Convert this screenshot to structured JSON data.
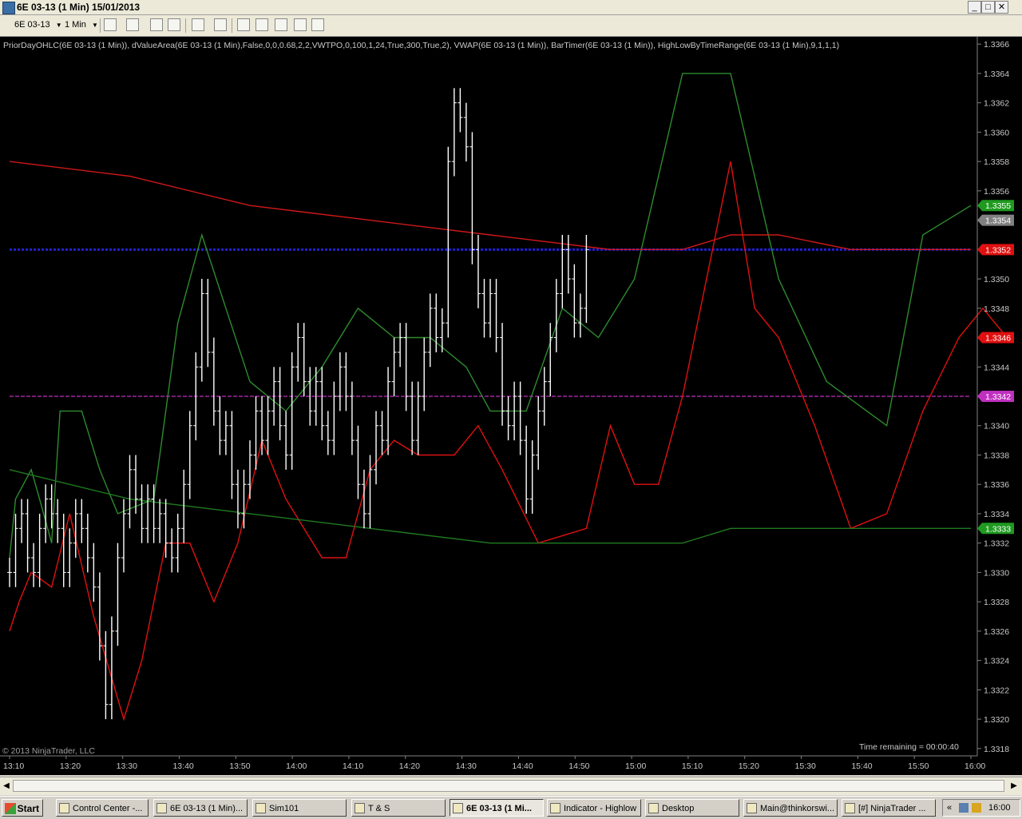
{
  "window": {
    "title": "6E 03-13 (1 Min)  15/01/2013",
    "controls": [
      "_",
      "□",
      "✕"
    ]
  },
  "toolbar": {
    "instrument": "6E 03-13",
    "interval": "1 Min"
  },
  "chart": {
    "indicator_line": "PriorDayOHLC(6E 03-13 (1 Min)), dValueArea(6E 03-13 (1 Min),False,0,0,0.68,2,2,VWTPO,0,100,1,24,True,300,True,2), VWAP(6E 03-13 (1 Min)), BarTimer(6E 03-13 (1 Min)), HighLowByTimeRange(6E 03-13 (1 Min),9,1,1,1)",
    "copyright": "© 2013 NinjaTrader, LLC",
    "time_remaining": "Time remaining = 00:00:40",
    "colors": {
      "background": "#000000",
      "bars": "#ffffff",
      "high_band": "#2e8b2e",
      "low_band": "#e01010",
      "vwap": "#d01818",
      "value_area": "#2020d0",
      "poc": "#c030c0",
      "lower_green": "#1f7a1f"
    }
  },
  "chart_data": {
    "type": "line",
    "instrument": "6E 03-13",
    "interval": "1 Min",
    "x_ticks": [
      "13:10",
      "13:20",
      "13:30",
      "13:40",
      "13:50",
      "14:00",
      "14:10",
      "14:20",
      "14:30",
      "14:40",
      "14:50",
      "15:00",
      "15:10",
      "15:20",
      "15:30",
      "15:40",
      "15:50",
      "16:00"
    ],
    "y_ticks": [
      "1.3318",
      "1.3320",
      "1.3322",
      "1.3324",
      "1.3326",
      "1.3328",
      "1.3330",
      "1.3332",
      "1.3334",
      "1.3336",
      "1.3338",
      "1.3340",
      "1.3342",
      "1.3344",
      "1.3346",
      "1.3348",
      "1.3350",
      "1.3352",
      "1.3354",
      "1.3356",
      "1.3358",
      "1.3360",
      "1.3362",
      "1.3364",
      "1.3366"
    ],
    "ylim": [
      1.33175,
      1.33665
    ],
    "price_markers": [
      {
        "label": "1.3355",
        "value": 1.3355,
        "color": "#1f9a1f"
      },
      {
        "label": "1.3354",
        "value": 1.3354,
        "color": "#808080"
      },
      {
        "label": "1.3352",
        "value": 1.3352,
        "color": "#e01010"
      },
      {
        "label": "1.3346",
        "value": 1.3346,
        "color": "#e01010"
      },
      {
        "label": "1.3342",
        "value": 1.3342,
        "color": "#c030c0"
      },
      {
        "label": "1.3333",
        "value": 1.3333,
        "color": "#1f9a1f"
      }
    ],
    "horizontal_levels": [
      {
        "name": "value-area-high",
        "value": 1.3352
      },
      {
        "name": "point-of-control",
        "value": 1.3342
      }
    ],
    "series": [
      {
        "key": "high_band",
        "points": [
          [
            0,
            1.3331
          ],
          [
            5,
            1.3335
          ],
          [
            18,
            1.3337
          ],
          [
            25,
            1.3335
          ],
          [
            35,
            1.3332
          ],
          [
            42,
            1.3341
          ],
          [
            60,
            1.3341
          ],
          [
            75,
            1.3337
          ],
          [
            90,
            1.3334
          ],
          [
            120,
            1.3335
          ],
          [
            140,
            1.3347
          ],
          [
            160,
            1.3353
          ],
          [
            180,
            1.3348
          ],
          [
            200,
            1.3343
          ],
          [
            230,
            1.3341
          ],
          [
            260,
            1.3344
          ],
          [
            290,
            1.3348
          ],
          [
            320,
            1.3346
          ],
          [
            350,
            1.3346
          ],
          [
            380,
            1.3344
          ],
          [
            400,
            1.3341
          ],
          [
            430,
            1.3341
          ],
          [
            460,
            1.3348
          ],
          [
            490,
            1.3346
          ],
          [
            520,
            1.335
          ],
          [
            560,
            1.3364
          ],
          [
            600,
            1.3364
          ],
          [
            640,
            1.335
          ],
          [
            680,
            1.3343
          ],
          [
            730,
            1.334
          ],
          [
            760,
            1.3353
          ],
          [
            800,
            1.3355
          ]
        ]
      },
      {
        "key": "low_band",
        "points": [
          [
            0,
            1.3326
          ],
          [
            8,
            1.3328
          ],
          [
            18,
            1.333
          ],
          [
            35,
            1.3329
          ],
          [
            50,
            1.3334
          ],
          [
            70,
            1.3327
          ],
          [
            95,
            1.332
          ],
          [
            110,
            1.3324
          ],
          [
            130,
            1.3332
          ],
          [
            150,
            1.3332
          ],
          [
            170,
            1.3328
          ],
          [
            190,
            1.3332
          ],
          [
            210,
            1.3339
          ],
          [
            230,
            1.3335
          ],
          [
            260,
            1.3331
          ],
          [
            280,
            1.3331
          ],
          [
            300,
            1.3337
          ],
          [
            320,
            1.3339
          ],
          [
            340,
            1.3338
          ],
          [
            370,
            1.3338
          ],
          [
            390,
            1.334
          ],
          [
            410,
            1.3337
          ],
          [
            440,
            1.3332
          ],
          [
            480,
            1.3333
          ],
          [
            500,
            1.334
          ],
          [
            520,
            1.3336
          ],
          [
            540,
            1.3336
          ],
          [
            560,
            1.3342
          ],
          [
            600,
            1.3358
          ],
          [
            620,
            1.3348
          ],
          [
            640,
            1.3346
          ],
          [
            670,
            1.334
          ],
          [
            700,
            1.3333
          ],
          [
            730,
            1.3334
          ],
          [
            760,
            1.3341
          ],
          [
            790,
            1.3346
          ],
          [
            810,
            1.3348
          ],
          [
            830,
            1.3346
          ]
        ]
      },
      {
        "key": "vwap",
        "points": [
          [
            0,
            1.3358
          ],
          [
            100,
            1.3357
          ],
          [
            200,
            1.3355
          ],
          [
            300,
            1.3354
          ],
          [
            400,
            1.3353
          ],
          [
            500,
            1.3352
          ],
          [
            560,
            1.3352
          ],
          [
            600,
            1.3353
          ],
          [
            640,
            1.3353
          ],
          [
            700,
            1.3352
          ],
          [
            760,
            1.3352
          ],
          [
            800,
            1.3352
          ]
        ]
      },
      {
        "key": "lower_green",
        "points": [
          [
            0,
            1.3337
          ],
          [
            100,
            1.3335
          ],
          [
            200,
            1.3334
          ],
          [
            300,
            1.3333
          ],
          [
            400,
            1.3332
          ],
          [
            500,
            1.3332
          ],
          [
            560,
            1.3332
          ],
          [
            600,
            1.3333
          ],
          [
            700,
            1.3333
          ],
          [
            760,
            1.3333
          ],
          [
            800,
            1.3333
          ]
        ]
      }
    ],
    "price_bars": {
      "color": "#ffffff",
      "points": [
        [
          0,
          1.333
        ],
        [
          5,
          1.3333
        ],
        [
          10,
          1.3334
        ],
        [
          15,
          1.3331
        ],
        [
          20,
          1.333
        ],
        [
          25,
          1.3333
        ],
        [
          30,
          1.3335
        ],
        [
          35,
          1.3334
        ],
        [
          40,
          1.3333
        ],
        [
          45,
          1.333
        ],
        [
          50,
          1.3332
        ],
        [
          55,
          1.3334
        ],
        [
          60,
          1.3333
        ],
        [
          65,
          1.3331
        ],
        [
          70,
          1.3329
        ],
        [
          75,
          1.3325
        ],
        [
          80,
          1.3321
        ],
        [
          85,
          1.3326
        ],
        [
          90,
          1.3331
        ],
        [
          95,
          1.3334
        ],
        [
          100,
          1.3337
        ],
        [
          105,
          1.3335
        ],
        [
          110,
          1.3333
        ],
        [
          115,
          1.3335
        ],
        [
          120,
          1.3333
        ],
        [
          125,
          1.3334
        ],
        [
          130,
          1.3332
        ],
        [
          135,
          1.3331
        ],
        [
          140,
          1.3333
        ],
        [
          145,
          1.3336
        ],
        [
          150,
          1.334
        ],
        [
          155,
          1.3344
        ],
        [
          160,
          1.3349
        ],
        [
          165,
          1.3345
        ],
        [
          170,
          1.3341
        ],
        [
          175,
          1.3339
        ],
        [
          180,
          1.334
        ],
        [
          185,
          1.3336
        ],
        [
          190,
          1.3334
        ],
        [
          195,
          1.3336
        ],
        [
          200,
          1.3338
        ],
        [
          205,
          1.3341
        ],
        [
          210,
          1.3339
        ],
        [
          215,
          1.3341
        ],
        [
          220,
          1.3343
        ],
        [
          225,
          1.334
        ],
        [
          230,
          1.3338
        ],
        [
          235,
          1.3344
        ],
        [
          240,
          1.3346
        ],
        [
          245,
          1.3343
        ],
        [
          250,
          1.3341
        ],
        [
          255,
          1.3343
        ],
        [
          260,
          1.334
        ],
        [
          265,
          1.3339
        ],
        [
          270,
          1.3342
        ],
        [
          275,
          1.3344
        ],
        [
          280,
          1.3342
        ],
        [
          285,
          1.3339
        ],
        [
          290,
          1.3336
        ],
        [
          295,
          1.3334
        ],
        [
          300,
          1.3337
        ],
        [
          305,
          1.334
        ],
        [
          310,
          1.3339
        ],
        [
          315,
          1.3343
        ],
        [
          320,
          1.3345
        ],
        [
          325,
          1.3346
        ],
        [
          330,
          1.3342
        ],
        [
          335,
          1.3339
        ],
        [
          340,
          1.3342
        ],
        [
          345,
          1.3345
        ],
        [
          350,
          1.3348
        ],
        [
          355,
          1.3346
        ],
        [
          360,
          1.3347
        ],
        [
          365,
          1.3358
        ],
        [
          370,
          1.3362
        ],
        [
          375,
          1.3361
        ],
        [
          380,
          1.3359
        ],
        [
          385,
          1.3352
        ],
        [
          390,
          1.3349
        ],
        [
          395,
          1.3347
        ],
        [
          400,
          1.3349
        ],
        [
          405,
          1.3346
        ],
        [
          410,
          1.3341
        ],
        [
          415,
          1.334
        ],
        [
          420,
          1.3342
        ],
        [
          425,
          1.3339
        ],
        [
          430,
          1.3335
        ],
        [
          435,
          1.3338
        ],
        [
          440,
          1.3341
        ],
        [
          445,
          1.3343
        ],
        [
          450,
          1.3346
        ],
        [
          455,
          1.3349
        ],
        [
          460,
          1.3352
        ],
        [
          465,
          1.335
        ],
        [
          470,
          1.3347
        ],
        [
          475,
          1.3348
        ],
        [
          480,
          1.3352
        ]
      ]
    }
  }
}
